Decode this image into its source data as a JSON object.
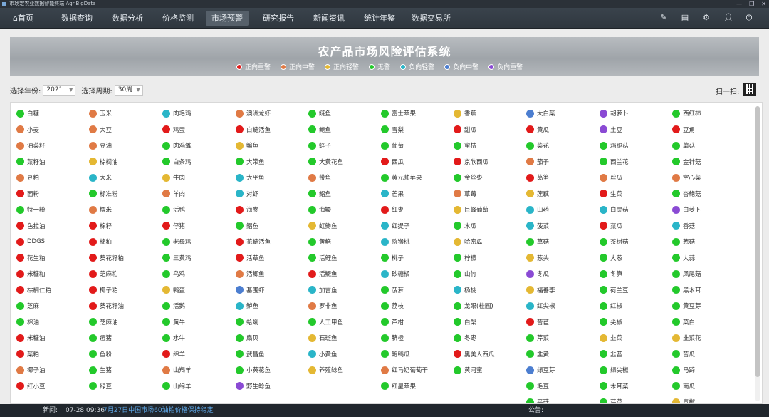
{
  "window": {
    "title": "市场宏农业数据智能终端 AgriBigData",
    "controls": [
      "—",
      "❐",
      "✕"
    ]
  },
  "nav": {
    "items": [
      {
        "label": "⌂首页"
      },
      {
        "label": "数据查询"
      },
      {
        "label": "数据分析"
      },
      {
        "label": "价格监测"
      },
      {
        "label": "市场预警",
        "active": true
      },
      {
        "label": "研究报告"
      },
      {
        "label": "新闻资讯"
      },
      {
        "label": "统计年鉴"
      },
      {
        "label": "数据交易所"
      }
    ],
    "icons": [
      "edit-icon",
      "report-icon",
      "settings-icon",
      "user-icon",
      "exit-icon"
    ]
  },
  "banner": {
    "title": "农产品市场风险评估系统"
  },
  "colors": {
    "zheng_zhong": "#e21a1a",
    "zheng_zhongjing": "#e07a45",
    "zheng_qing": "#e4b833",
    "wu": "#23c92b",
    "fu_qing": "#2ab5c8",
    "fu_zhong": "#4c7ed0",
    "fu_zhongjing": "#8a4ad4"
  },
  "legend": [
    {
      "label": "正向重警",
      "color": "#e21a1a"
    },
    {
      "label": "正向中警",
      "color": "#e07a45"
    },
    {
      "label": "正向轻警",
      "color": "#e4b833"
    },
    {
      "label": "无警",
      "color": "#23c92b"
    },
    {
      "label": "负向轻警",
      "color": "#2ab5c8"
    },
    {
      "label": "负向中警",
      "color": "#4c7ed0"
    },
    {
      "label": "负向重警",
      "color": "#8a4ad4"
    }
  ],
  "filters": {
    "year_label": "选择年份:",
    "year_value": "2021",
    "period_label": "选择周期:",
    "period_value": "30周"
  },
  "scan_label": "扫一扫:",
  "products": [
    [
      "白糖|w",
      "玉米|o",
      "肉毛鸡|c",
      "澳洲龙虾|o",
      "鲢鱼|w",
      "富士苹果|w",
      "香蕉|y",
      "大白菜|b",
      "胡萝卜|p",
      "西红柿|w"
    ],
    [
      "小麦|o",
      "大豆|o",
      "鸡蛋|r",
      "白鲢活鱼|r",
      "鲍鱼|w",
      "雪梨|w",
      "甜瓜|r",
      "黄瓜|r",
      "土豆|p",
      "豆角|r"
    ],
    [
      "油菜籽|o",
      "豆油|o",
      "肉鸡雏|w",
      "鳊鱼|y",
      "蛏子|w",
      "葡萄|w",
      "蜜桔|w",
      "菜花|w",
      "鸡腿菇|w",
      "蘑菇|w"
    ],
    [
      "菜籽油|w",
      "棕榈油|y",
      "白条鸡|w",
      "大带鱼|w",
      "大黄花鱼|w",
      "西瓜|r",
      "京欣西瓜|r",
      "茄子|o",
      "西兰花|w",
      "金针菇|w"
    ],
    [
      "豆粕|o",
      "大米|c",
      "牛肉|y",
      "大平鱼|c",
      "带鱼|o",
      "黄元帅苹果|w",
      "金丝枣|w",
      "莴笋|r",
      "丝瓜|o",
      "空心菜|o"
    ],
    [
      "面粉|r",
      "标准粉|w",
      "羊肉|o",
      "对虾|c",
      "鲳鱼|w",
      "芒果|c",
      "草莓|o",
      "莲藕|y",
      "生菜|r",
      "杏鲍菇|w"
    ],
    [
      "特一粉|w",
      "糯米|o",
      "活鸭|w",
      "海参|r",
      "海鳗|w",
      "红枣|r",
      "巨峰葡萄|y",
      "山药|c",
      "白灵菇|c",
      "白萝卜|p"
    ],
    [
      "色拉油|r",
      "棉籽|r",
      "仔猪|r",
      "鲳鱼|w",
      "虹鳟鱼|y",
      "红提子|c",
      "木瓜|w",
      "菠菜|c",
      "菜瓜|r",
      "香菇|c"
    ],
    [
      "DDGS|r",
      "棉粕|r",
      "老母鸡|w",
      "花鲢活鱼|r",
      "黄鳝|w",
      "猕猴桃|c",
      "哈密瓜|y",
      "草菇|w",
      "茶树菇|w",
      "葱菇|w"
    ],
    [
      "花生粕|r",
      "葵花籽粕|r",
      "三黄鸡|w",
      "活草鱼|r",
      "活鲤鱼|w",
      "桃子|w",
      "柠檬|w",
      "葱头|y",
      "大葱|w",
      "大蒜|w"
    ],
    [
      "米糠粕|r",
      "芝麻粕|r",
      "乌鸡|w",
      "活鲫鱼|o",
      "活鳜鱼|r",
      "砂糖橘|c",
      "山竹|w",
      "冬瓜|p",
      "冬笋|w",
      "凤尾菇|w"
    ],
    [
      "棕榈仁粕|r",
      "椰子粕|r",
      "鸭蛋|y",
      "基围虾|b",
      "加吉鱼|c",
      "菠萝|w",
      "杨桃|c",
      "福善李|y",
      "荷兰豆|w",
      "黑木耳|w"
    ],
    [
      "芝麻|w",
      "葵花籽油|r",
      "活鹅|w",
      "鲈鱼|c",
      "罗非鱼|o",
      "荔枝|w",
      "龙眼(桂圆)|w",
      "红尖椒|c",
      "红椒|w",
      "黄豆芽|w"
    ],
    [
      "棉油|w",
      "芝麻油|w",
      "黄牛|w",
      "蛤蜊|w",
      "人工甲鱼|w",
      "芦柑|w",
      "白梨|w",
      "苦苣|r",
      "尖椒|w",
      "菜白|w"
    ],
    [
      "米糠油|r",
      "痘猪|w",
      "水牛|w",
      "扇贝|w",
      "石斑鱼|y",
      "脐橙|w",
      "冬枣|w",
      "芹菜|w",
      "韭菜|y",
      "韭菜花|y"
    ],
    [
      "菜粕|r",
      "鱼粉|w",
      "绵羊|r",
      "武昌鱼|w",
      "小黄鱼|c",
      "鲍鸭瓜|w",
      "黑美人西瓜|r",
      "韭黄|w",
      "韭苔|w",
      "苦瓜|w"
    ],
    [
      "椰子油|o",
      "生猪|w",
      "山羯羊|o",
      "小黄花鱼|w",
      "养殖鲶鱼|y",
      "红马奶葡萄干|o",
      "黄河蜜|w",
      "绿豆芽|b",
      "绿尖椒|w",
      "马蹄|w"
    ],
    [
      "红小豆|r",
      "绿豆|w",
      "山绵羊|w",
      "野生鲶鱼|p",
      "",
      "红星苹果|w",
      "",
      "毛豆|w",
      "木耳菜|w",
      "南瓜|w"
    ],
    [
      "",
      "",
      "",
      "",
      "",
      "",
      "",
      "平菇|w",
      "芹菜|w",
      "青椒|y"
    ]
  ],
  "footer": {
    "news_label": "新闻:",
    "news_time": "07-28 09:36",
    "news_text": "7月27日中国市场60油粕价格保持稳定",
    "notice_label": "公告:"
  }
}
